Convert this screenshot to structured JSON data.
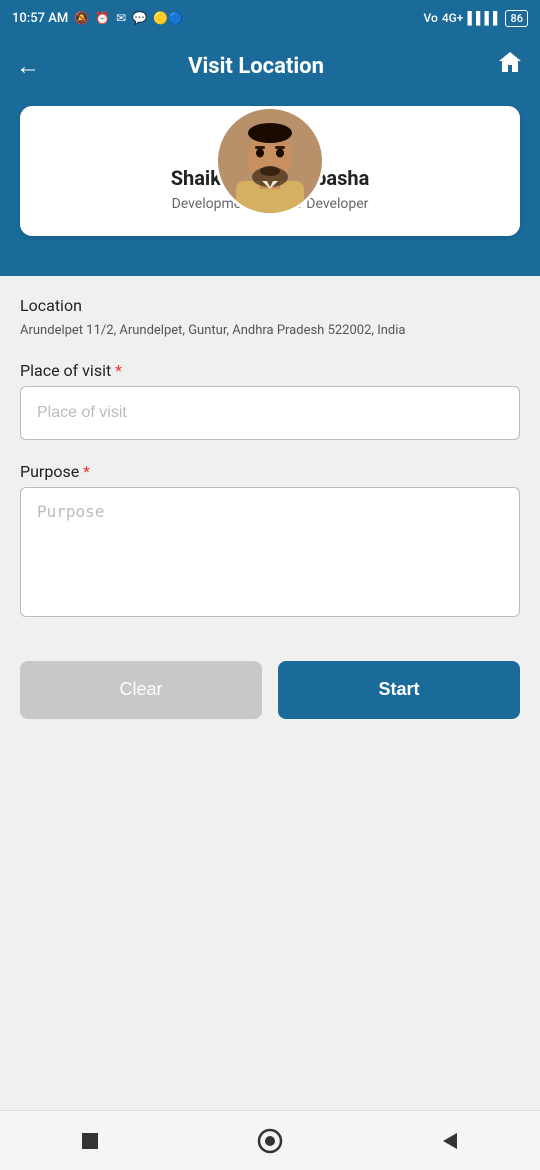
{
  "statusBar": {
    "time": "10:57 AM",
    "batteryLevel": "86"
  },
  "navBar": {
    "title": "Visit Location",
    "backIcon": "←",
    "homeIcon": "🏠"
  },
  "profile": {
    "name": "Shaik Mohiddin basha",
    "department": "Development",
    "role": "Senior Developer",
    "roleText": "Development  , Senior Developer"
  },
  "location": {
    "label": "Location",
    "address": "Arundelpet 11/2, Arundelpet, Guntur, Andhra Pradesh 522002, India"
  },
  "placeOfVisit": {
    "label": "Place of visit",
    "requiredStar": "*",
    "placeholder": "Place of visit"
  },
  "purpose": {
    "label": "Purpose",
    "requiredStar": "*",
    "placeholder": "Purpose"
  },
  "buttons": {
    "clear": "Clear",
    "start": "Start"
  },
  "bottomNav": {
    "stopIcon": "■",
    "homeIcon": "⬤",
    "backIcon": "◀"
  }
}
